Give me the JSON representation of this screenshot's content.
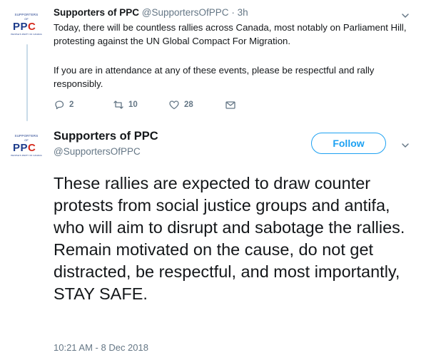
{
  "tweet1": {
    "avatar": {
      "top": "SUPPORTERS",
      "of": "OF",
      "ppc_main": "PP",
      "ppc_c": "C",
      "bottom": "PEOPLE'S PARTY OF CANADA"
    },
    "name": "Supporters of PPC",
    "handle": "@SupportersOfPPC",
    "separator": "·",
    "time": "3h",
    "text1": "Today, there will be countless rallies across Canada, most notably on Parliament Hill, protesting against the UN Global Compact For Migration.",
    "text2": "If you are in attendance at any of these events, please be respectful and rally responsibly.",
    "actions": {
      "replies": "2",
      "retweets": "10",
      "likes": "28"
    }
  },
  "tweet2": {
    "avatar": {
      "top": "SUPPORTERS",
      "of": "OF",
      "ppc_main": "PP",
      "ppc_c": "C",
      "bottom": "PEOPLE'S PARTY OF CANADA"
    },
    "name": "Supporters of PPC",
    "handle": "@SupportersOfPPC",
    "follow_label": "Follow",
    "text": "These rallies are expected to draw counter protests from social justice groups and antifa, who will aim to disrupt and sabotage the rallies. Remain motivated on the cause, do not get distracted, be respectful, and most importantly, STAY SAFE.",
    "timestamp": "10:21 AM - 8 Dec 2018"
  },
  "colors": {
    "accent": "#1da1f2",
    "muted": "#657786",
    "thread": "#c9dbe8",
    "brand_blue": "#1b3a8a",
    "brand_red": "#d52b1e"
  }
}
